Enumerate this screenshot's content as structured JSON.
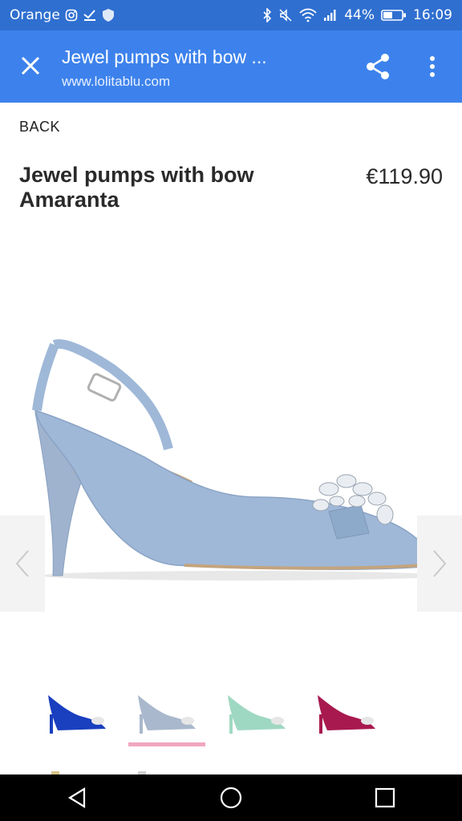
{
  "status_bar": {
    "carrier": "Orange",
    "battery": "44%",
    "time": "16:09",
    "icons": [
      "instagram-icon",
      "download-check-icon",
      "shield-icon",
      "bluetooth-icon",
      "mute-icon",
      "wifi-icon",
      "signal-icon",
      "battery-icon"
    ]
  },
  "app_bar": {
    "title": "Jewel pumps with bow ...",
    "url": "www.lolitablu.com",
    "icons": [
      "close-icon",
      "share-icon",
      "more-vert-icon"
    ]
  },
  "product": {
    "back_label": "BACK",
    "title": "Jewel pumps with bow Amaranta",
    "price": "€119.90"
  },
  "gallery": {
    "main_color": "#9fb8d8",
    "thumbnails": [
      {
        "name": "blue",
        "color": "#1a3fbf"
      },
      {
        "name": "light-blue",
        "color": "#a9b8cc"
      },
      {
        "name": "mint",
        "color": "#9fd8c2"
      },
      {
        "name": "fuchsia",
        "color": "#a8194f"
      }
    ],
    "selected_index": 1
  },
  "nav_bar": {
    "icons": [
      "back-icon",
      "home-icon",
      "recents-icon"
    ]
  }
}
